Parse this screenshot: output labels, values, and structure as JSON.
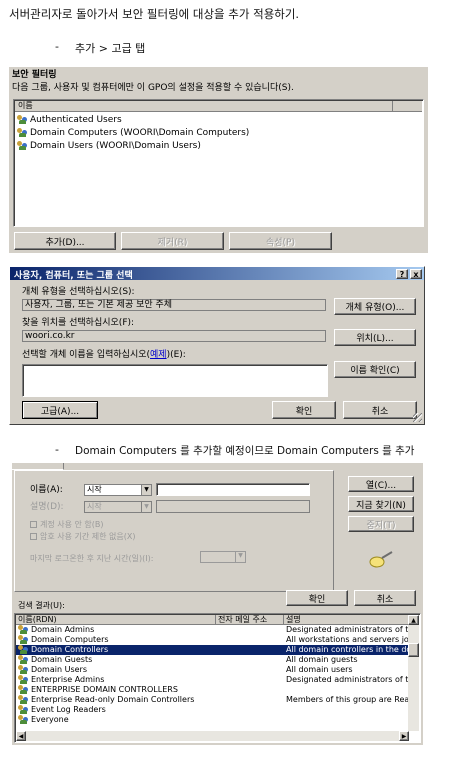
{
  "doc": {
    "line1": "서버관리자로 돌아가서 보안 필터링에 대상을 추가 적용하기.",
    "bullet1": "-",
    "line2": "추가 > 고급 탭",
    "bullet2": "-",
    "line3": "Domain Computers 를 추가할 예정이므로 Domain Computers 를 추가"
  },
  "security_filter": {
    "title": "보안 필터링",
    "description": "다음 그룹, 사용자 및 컴퓨터에만 이 GPO의 설정을 적용할 수 있습니다(S).",
    "column_header": "이름",
    "items": [
      "Authenticated Users",
      "Domain Computers (WOORI\\Domain Computers)",
      "Domain Users (WOORI\\Domain Users)"
    ],
    "add_button": "추가(D)...",
    "remove_button": "제거(R)",
    "properties_button": "속성(P)"
  },
  "select_dialog": {
    "title": "사용자, 컴퓨터, 또는 그룹 선택",
    "help_btn": "?",
    "close_btn": "x",
    "object_type_label": "개체 유형을 선택하십시오(S):",
    "object_type_value": "사용자, 그룹, 또는 기본 제공 보안 주체",
    "object_type_button": "개체 유형(O)...",
    "location_label": "찾을 위치를 선택하십시오(F):",
    "location_value": "woori.co.kr",
    "location_button": "위치(L)...",
    "names_label_prefix": "선택할 개체 이름을 입력하십시오(",
    "names_label_link": "예제",
    "names_label_suffix": ")(E):",
    "check_names_button": "이름 확인(C)",
    "advanced_button": "고급(A)...",
    "ok_button": "확인",
    "cancel_button": "취소"
  },
  "advanced_dialog": {
    "name_label": "이름(A):",
    "name_op": "시작",
    "desc_label": "설명(D):",
    "desc_op": "시작",
    "disabled_accounts": "계정 사용 안 함(B)",
    "non_expiring_password": "암호 사용 기간 제한 없음(X)",
    "days_since_logon": "마지막 로그온한 후 지난 시간(일)(I):",
    "columns_button": "열(C)...",
    "find_now_button": "지금 찾기(N)",
    "stop_button": "중지(T)",
    "ok_button": "확인",
    "cancel_button": "취소",
    "results_label": "검색 결과(U):",
    "col_name": "이름(RDN)",
    "col_email": "전자 메일 주소",
    "col_desc": "설명",
    "results": [
      {
        "name": "Domain Admins",
        "desc": "Designated administrators of the"
      },
      {
        "name": "Domain Computers",
        "desc": "All workstations and servers join"
      },
      {
        "name": "Domain Controllers",
        "desc": "All domain controllers in the dom"
      },
      {
        "name": "Domain Guests",
        "desc": "All domain guests"
      },
      {
        "name": "Domain Users",
        "desc": "All domain users"
      },
      {
        "name": "Enterprise Admins",
        "desc": "Designated administrators of the"
      },
      {
        "name": "ENTERPRISE DOMAIN CONTROLLERS",
        "desc": ""
      },
      {
        "name": "Enterprise Read-only Domain Controllers",
        "desc": "Members of this group are Read"
      },
      {
        "name": "Event Log Readers",
        "desc": ""
      },
      {
        "name": "Everyone",
        "desc": ""
      }
    ]
  }
}
